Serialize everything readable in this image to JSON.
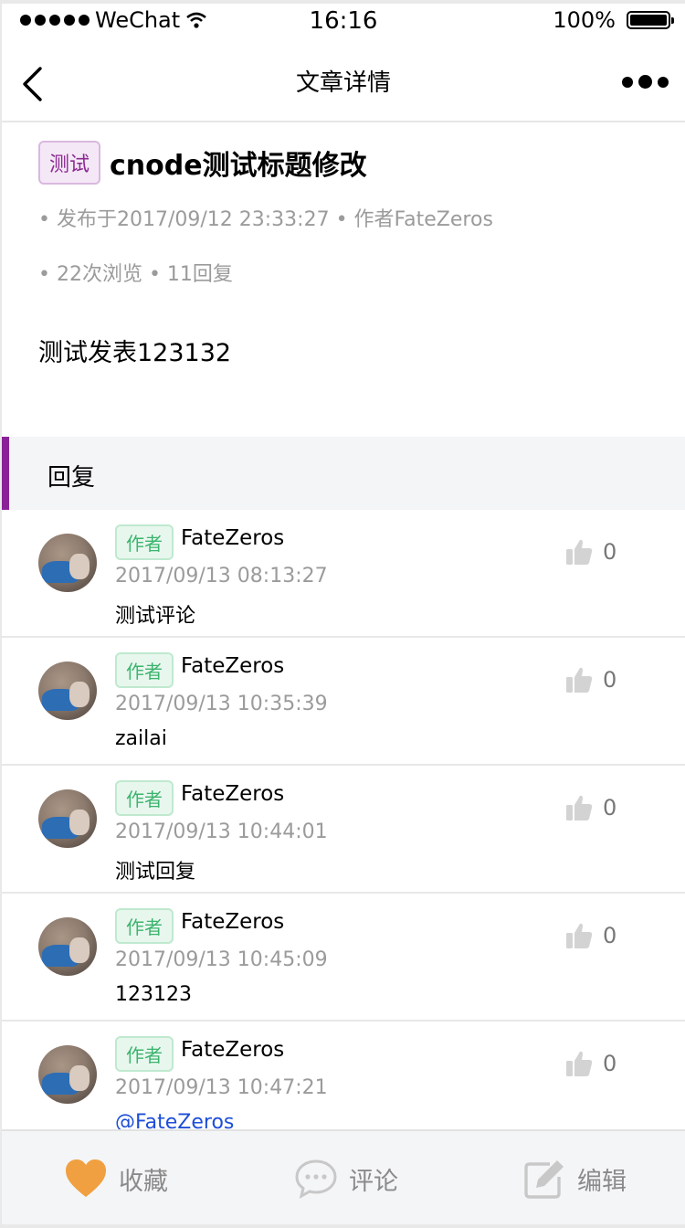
{
  "status_bar": {
    "carrier": "WeChat",
    "time": "16:16",
    "battery": "100%"
  },
  "nav": {
    "title": "文章详情"
  },
  "article": {
    "tag": "测试",
    "title": "cnode测试标题修改",
    "meta_published": "• 发布于2017/09/12 23:33:27 • 作者FateZeros",
    "meta_stats": "• 22次浏览 • 11回复",
    "body": "测试发表123132"
  },
  "replies_section": {
    "title": "回复"
  },
  "replies": [
    {
      "tag": "作者",
      "user": "FateZeros",
      "time": "2017/09/13 08:13:27",
      "content": "测试评论",
      "likes": "0"
    },
    {
      "tag": "作者",
      "user": "FateZeros",
      "time": "2017/09/13 10:35:39",
      "content": "zailai",
      "likes": "0"
    },
    {
      "tag": "作者",
      "user": "FateZeros",
      "time": "2017/09/13 10:44:01",
      "content": "测试回复",
      "likes": "0"
    },
    {
      "tag": "作者",
      "user": "FateZeros",
      "time": "2017/09/13 10:45:09",
      "content": "123123",
      "likes": "0"
    },
    {
      "tag": "作者",
      "user": "FateZeros",
      "time": "2017/09/13 10:47:21",
      "content": "@FateZeros",
      "likes": "0"
    }
  ],
  "bottom_bar": {
    "favorite_label": "收藏",
    "comment_label": "评论",
    "edit_label": "编辑"
  },
  "colors": {
    "accent": "#8a2297",
    "author_tag": "#3cb46e",
    "favorite": "#f0a040",
    "mention": "#1d4ed8"
  }
}
